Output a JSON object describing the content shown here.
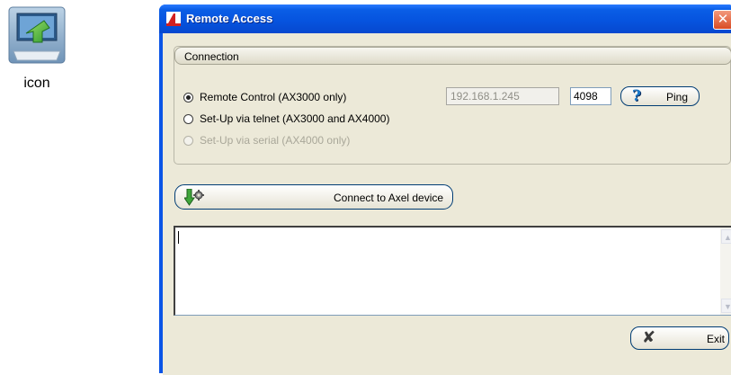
{
  "desktop_icon": {
    "label": "icon",
    "icon": "install-arrow-icon"
  },
  "window": {
    "title": "Remote Access",
    "title_icon": "app-logo-icon",
    "close_symbol": "✕"
  },
  "connection": {
    "header": "Connection",
    "options": [
      {
        "label": "Remote Control (AX3000 only)",
        "checked": true,
        "enabled": true
      },
      {
        "label": "Set-Up via telnet (AX3000 and AX4000)",
        "checked": false,
        "enabled": true
      },
      {
        "label": "Set-Up via serial (AX4000 only)",
        "checked": false,
        "enabled": false
      }
    ],
    "ip_address": "192.168.1.245",
    "port": "4098",
    "ping_icon_glyph": "?",
    "ping_label": "Ping"
  },
  "connect_button": {
    "label": "Connect to Axel device",
    "icon": "connect-arrow-gear-icon"
  },
  "log": {
    "text": ""
  },
  "exit_button": {
    "label": "Exit",
    "icon_glyph": "✘"
  },
  "colors": {
    "title_bar": "#0654df",
    "client_bg": "#ece9d8",
    "button_border": "#003c74"
  }
}
